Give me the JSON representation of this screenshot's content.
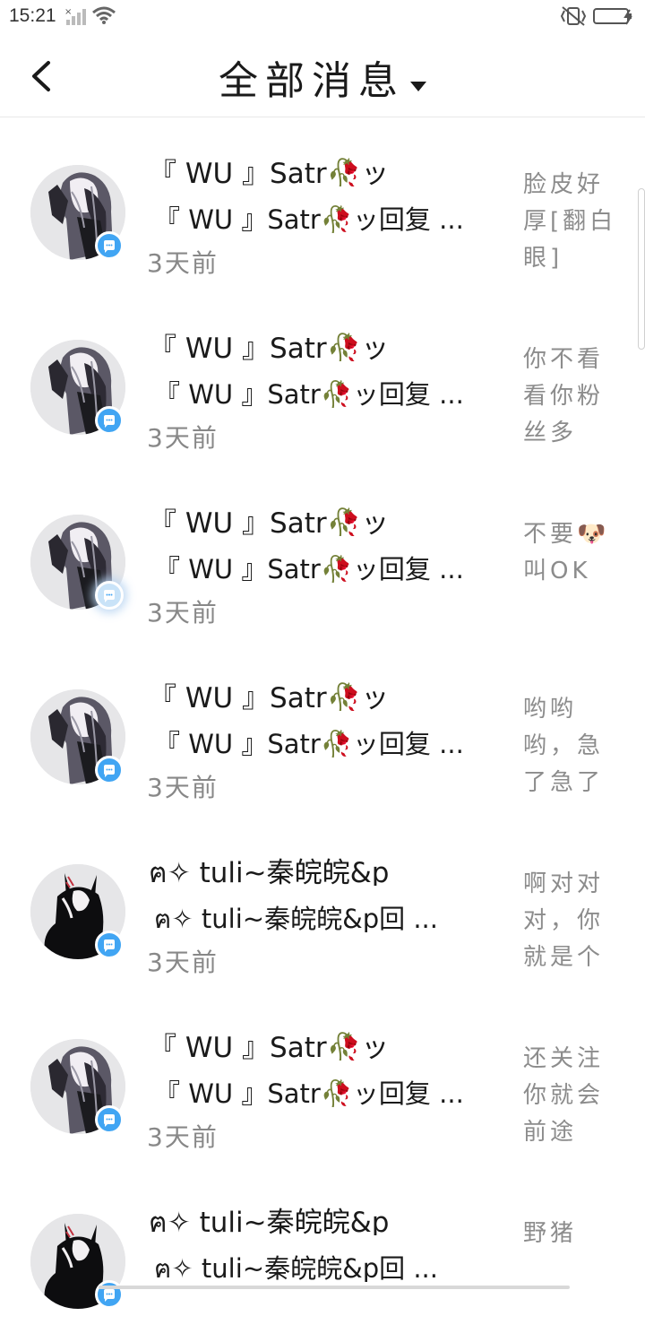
{
  "status_bar": {
    "time": "15:21"
  },
  "header": {
    "title": "全部消息"
  },
  "messages": [
    {
      "avatar": "gothic-girl",
      "name": "『 WU 』Satr🥀ッ",
      "reply": "『 WU 』Satr🥀ッ回复 ...",
      "time": "3天前",
      "preview": "脸皮好厚[翻白眼]",
      "badge_faded": false
    },
    {
      "avatar": "gothic-girl",
      "name": "『 WU 』Satr🥀ッ",
      "reply": "『 WU 』Satr🥀ッ回复 ...",
      "time": "3天前",
      "preview": "你不看看你粉丝多",
      "badge_faded": false
    },
    {
      "avatar": "gothic-girl",
      "name": "『 WU 』Satr🥀ッ",
      "reply": "『 WU 』Satr🥀ッ回复 ...",
      "time": "3天前",
      "preview": "不要🐶叫OK",
      "badge_faded": true
    },
    {
      "avatar": "gothic-girl",
      "name": "『 WU 』Satr🥀ッ",
      "reply": "『 WU 』Satr🥀ッ回复 ...",
      "time": "3天前",
      "preview": "哟哟哟，急了急了",
      "badge_faded": false
    },
    {
      "avatar": "demon-girl",
      "name": "ฅ✧ tuli~秦皖皖&p",
      "reply": "ฅ✧ tuli~秦皖皖&p回 ...",
      "time": "3天前",
      "preview": "啊对对对，你就是个",
      "badge_faded": false
    },
    {
      "avatar": "gothic-girl",
      "name": "『 WU 』Satr🥀ッ",
      "reply": "『 WU 』Satr🥀ッ回复 ...",
      "time": "3天前",
      "preview": "还关注你就会前途",
      "badge_faded": false
    },
    {
      "avatar": "demon-girl",
      "name": "ฅ✧ tuli~秦皖皖&p",
      "reply": "ฅ✧ tuli~秦皖皖&p回 ...",
      "time": "",
      "preview": "野猪",
      "badge_faded": false
    }
  ]
}
